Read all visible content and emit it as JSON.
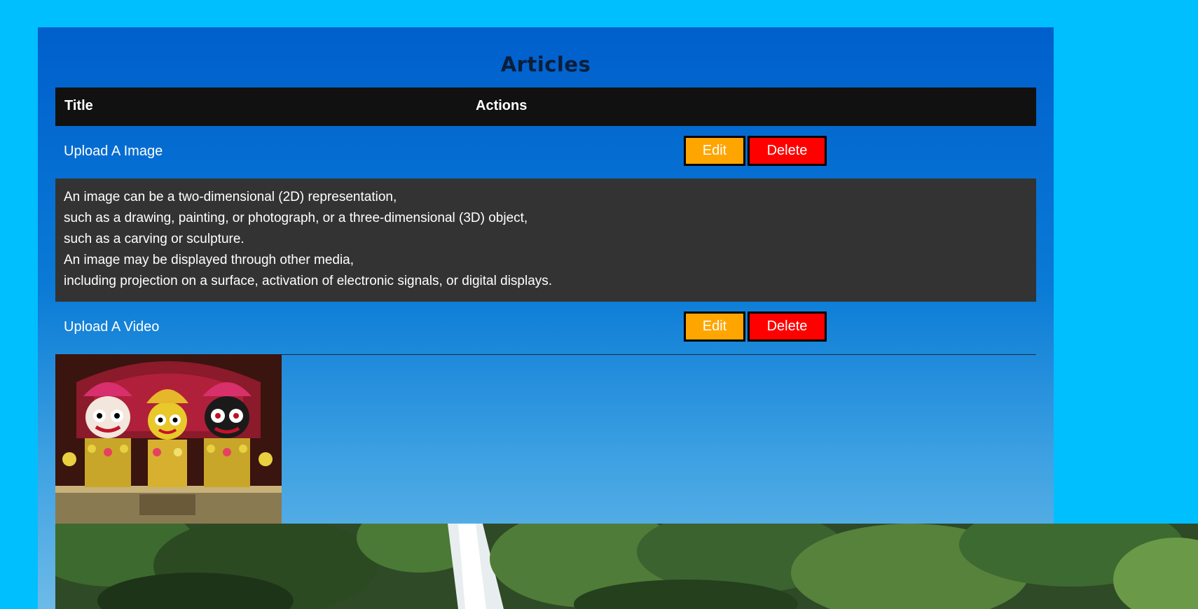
{
  "page": {
    "heading": "Articles"
  },
  "table": {
    "headers": {
      "title": "Title",
      "actions": "Actions"
    },
    "rows": [
      {
        "title": "Upload A Image",
        "edit_label": "Edit",
        "delete_label": "Delete",
        "description": [
          "An image can be a two-dimensional (2D) representation,",
          "such as a drawing, painting, or photograph, or a three-dimensional (3D) object,",
          "such as a carving or sculpture.",
          "An image may be displayed through other media,",
          "including projection on a surface, activation of electronic signals, or digital displays."
        ]
      },
      {
        "title": "Upload A Video",
        "edit_label": "Edit",
        "delete_label": "Delete"
      }
    ]
  },
  "media": {
    "deity_image": "temple-deities-photo",
    "background_image": "forest-waterfall-photo"
  },
  "colors": {
    "page_bg": "#00bfff",
    "header_bg": "#111111",
    "desc_bg": "#333333",
    "edit_btn": "#ffa500",
    "delete_btn": "#ff0000"
  }
}
